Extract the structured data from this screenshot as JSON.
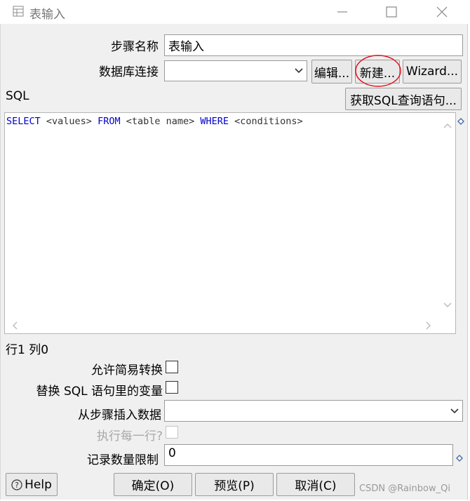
{
  "window": {
    "title": "表输入"
  },
  "fields": {
    "step_name_label": "步骤名称",
    "step_name_value": "表输入",
    "db_conn_label": "数据库连接",
    "db_conn_value": ""
  },
  "buttons": {
    "edit": "编辑...",
    "new": "新建...",
    "wizard": "Wizard...",
    "get_sql": "获取SQL查询语句...",
    "help": "Help",
    "ok": "确定(O)",
    "preview": "预览(P)",
    "cancel": "取消(C)"
  },
  "sql": {
    "label": "SQL",
    "tokens": [
      {
        "text": "SELECT",
        "kind": "keyword"
      },
      {
        "text": " <values> ",
        "kind": "plain"
      },
      {
        "text": "FROM",
        "kind": "keyword"
      },
      {
        "text": " <table name> ",
        "kind": "plain"
      },
      {
        "text": "WHERE",
        "kind": "keyword"
      },
      {
        "text": " <conditions>",
        "kind": "plain"
      }
    ]
  },
  "status": {
    "position": "行1 列0"
  },
  "options": {
    "lazy_conversion_label": "允许简易转换",
    "replace_vars_label": "替换 SQL 语句里的变量",
    "insert_from_step_label": "从步骤插入数据",
    "insert_from_step_value": "",
    "execute_each_row_label": "执行每一行?",
    "limit_label": "记录数量限制",
    "limit_value": "0"
  },
  "watermark": "CSDN @Rainbow_Qi",
  "colors": {
    "keyword": "#0000cc",
    "plain": "#333333",
    "highlight_circle": "#e0141e",
    "variable_icon": "#4a6fa5"
  }
}
